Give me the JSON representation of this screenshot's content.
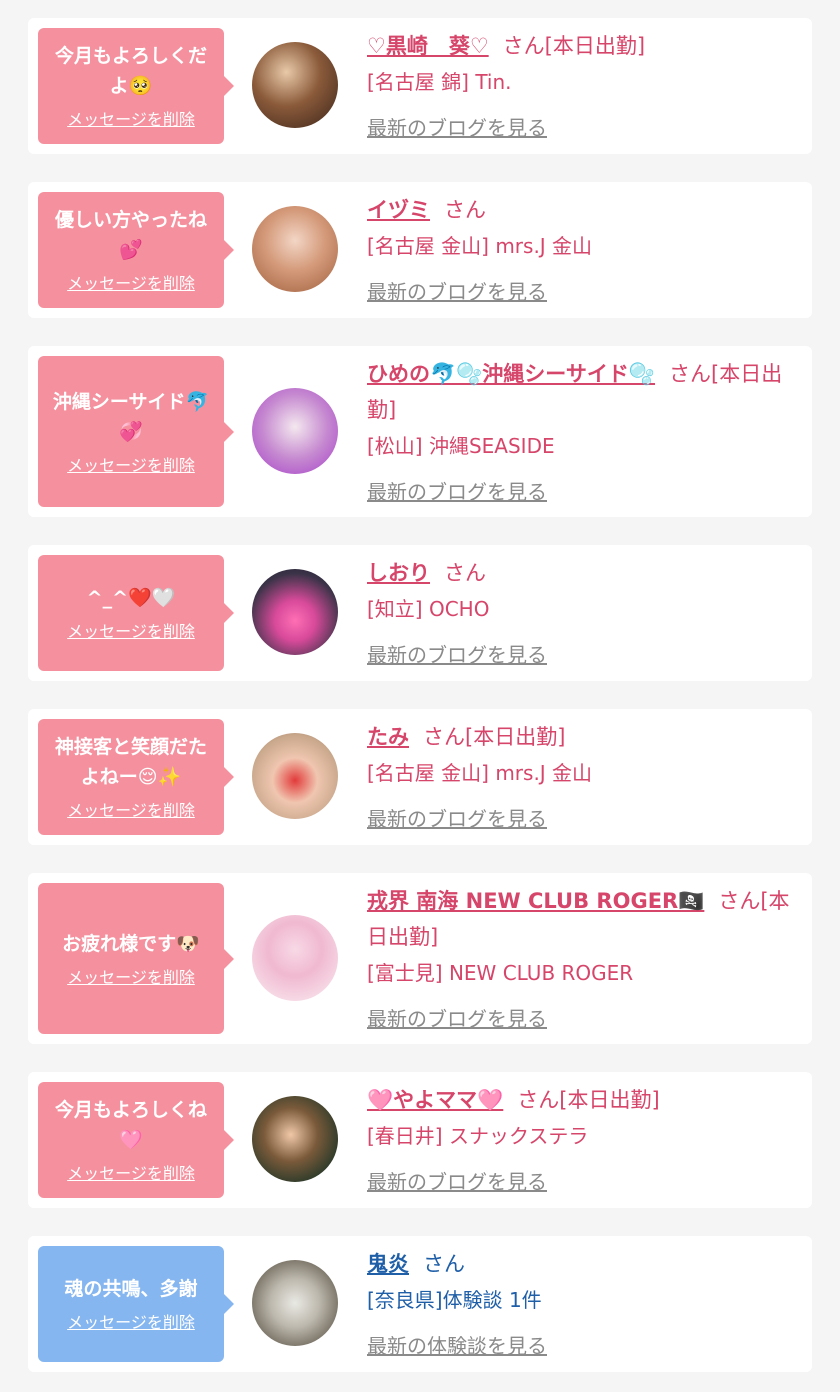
{
  "delete_label": "メッセージを削除",
  "blog_link": "最新のブログを見る",
  "review_link": "最新の体験談を見る",
  "cards": [
    {
      "message": "今月もよろしくだよ🥺",
      "name": "♡黒崎　葵♡",
      "san": "さん[本日出勤]",
      "place": "[名古屋 錦] Tin."
    },
    {
      "message": "優しい方やったね💕",
      "name": "イヅミ",
      "san": "さん",
      "place": "[名古屋 金山] mrs.J 金山"
    },
    {
      "message": "沖縄シーサイド🐬💞",
      "name": "ひめの🐬🫧沖縄シーサイド🫧",
      "san": "さん[本日出勤]",
      "place": "[松山] 沖縄SEASIDE"
    },
    {
      "message": "^_^❤️🤍",
      "name": "しおり",
      "san": "さん",
      "place": "[知立] OCHO"
    },
    {
      "message": "神接客と笑顔だたよねー😌✨",
      "name": "たみ",
      "san": "さん[本日出勤]",
      "place": "[名古屋 金山] mrs.J 金山"
    },
    {
      "message": "お疲れ様です🐶",
      "name": "戎界 南海 NEW CLUB ROGER🏴‍☠️",
      "san": "さん[本日出勤]",
      "place": "[富士見] NEW CLUB ROGER"
    },
    {
      "message": "今月もよろしくね🩷",
      "name": "🩷やよママ🩷",
      "san": "さん[本日出勤]",
      "place": "[春日井] スナックステラ"
    },
    {
      "message": "魂の共鳴、多謝",
      "name": "鬼炎",
      "san": "さん",
      "place": "[奈良県]体験談 1件"
    }
  ]
}
